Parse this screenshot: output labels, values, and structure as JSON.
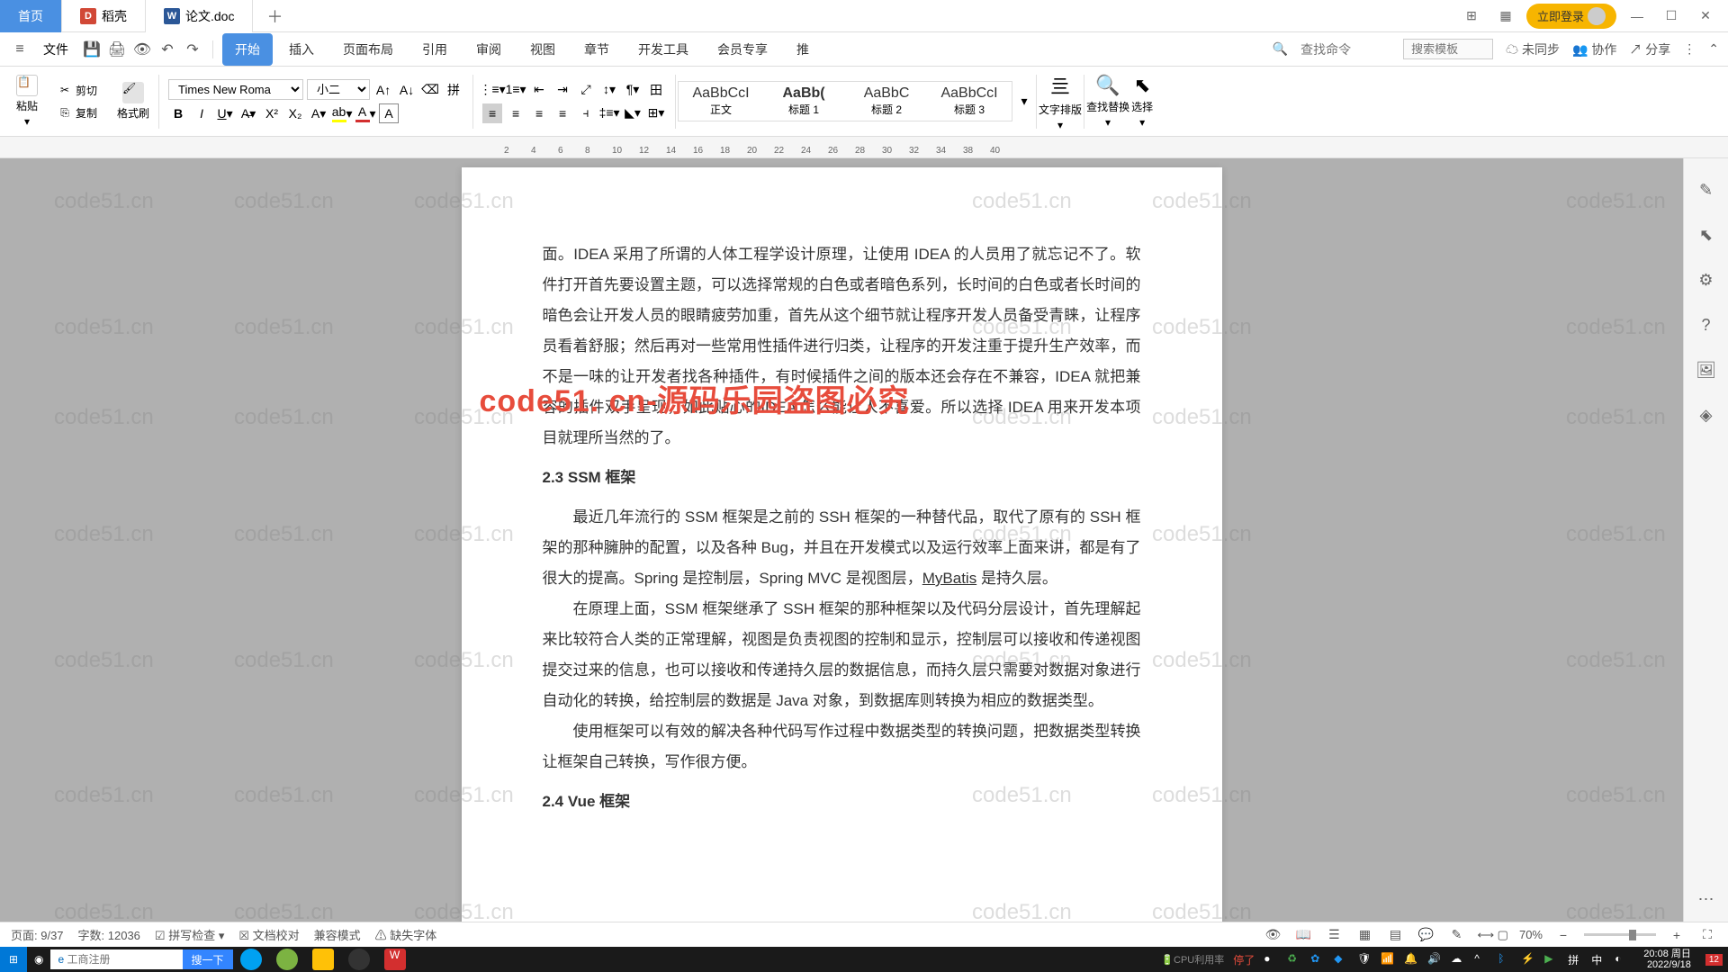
{
  "tabs": {
    "home": "首页",
    "docell": "稻壳",
    "doc": "论文.doc"
  },
  "title_right": {
    "login": "立即登录"
  },
  "file_menu": "文件",
  "menus": [
    "开始",
    "插入",
    "页面布局",
    "引用",
    "审阅",
    "视图",
    "章节",
    "开发工具",
    "会员专享",
    "推"
  ],
  "menu_right": {
    "search_cmd": "查找命令",
    "search_tpl": "搜索模板",
    "unsync": "未同步",
    "collab": "协作",
    "share": "分享"
  },
  "ribbon": {
    "paste": "粘贴",
    "cut": "剪切",
    "copy": "复制",
    "format_painter": "格式刷",
    "font_name": "Times New Roma",
    "font_size": "小二",
    "styles": [
      "正文",
      "标题 1",
      "标题 2",
      "标题 3"
    ],
    "style_preview": "AaBbCcI",
    "text_layout": "文字排版",
    "find_replace": "查找替换",
    "select": "选择"
  },
  "document": {
    "p1": "面。IDEA 采用了所谓的人体工程学设计原理，让使用 IDEA 的人员用了就忘记不了。软件打开首先要设置主题，可以选择常规的白色或者暗色系列，长时间的白色或者长时间的暗色会让开发人员的眼睛疲劳加重，首先从这个细节就让程序开发人员备受青睐，让程序员看着舒服；然后再对一些常用性插件进行归类，让程序的开发注重于提升生产效率，而不是一味的让开发者找各种插件，有时候插件之间的版本还会存在不兼容，IDEA 就把兼容的插件双手呈现，如此贴心的IDEA 怎么能让人不喜爱。所以选择 IDEA 用来开发本项目就理所当然的了。",
    "h1": "2.3 SSM 框架",
    "p2": "最近几年流行的 SSM 框架是之前的 SSH 框架的一种替代品，取代了原有的 SSH 框架的那种臃肿的配置，以及各种 Bug，并且在开发模式以及运行效率上面来讲，都是有了很大的提高。Spring 是控制层，Spring MVC 是视图层，",
    "mybatis": "MyBatis",
    "p2b": "是持久层。",
    "p3": "在原理上面，SSM 框架继承了 SSH 框架的那种框架以及代码分层设计，首先理解起来比较符合人类的正常理解，视图是负责视图的控制和显示，控制层可以接收和传递视图提交过来的信息，也可以接收和传递持久层的数据信息，而持久层只需要对数据对象进行自动化的转换，给控制层的数据是 Java 对象，到数据库则转换为相应的数据类型。",
    "p4": "使用框架可以有效的解决各种代码写作过程中数据类型的转换问题，把数据类型转换让框架自己转换，写作很方便。",
    "h2": "2.4 Vue 框架"
  },
  "watermark_red": "code51. cn-源码乐园盗图必究",
  "watermark_bg": "code51.cn",
  "status": {
    "page": "页面: 9/37",
    "words": "字数: 12036",
    "spell": "拼写检查",
    "proof": "文档校对",
    "compat": "兼容模式",
    "missing_font": "缺失字体",
    "zoom": "70%"
  },
  "taskbar": {
    "search_placeholder": "工商注册",
    "search_btn": "搜一下",
    "cpu_label": "CPU利用率",
    "stop": "停了",
    "time": "20:08 周日",
    "date": "2022/9/18",
    "badge": "12"
  },
  "ruler_ticks": [
    "2",
    "4",
    "6",
    "8",
    "10",
    "12",
    "14",
    "16",
    "18",
    "20",
    "22",
    "24",
    "26",
    "28",
    "30",
    "32",
    "34",
    "38",
    "40"
  ]
}
